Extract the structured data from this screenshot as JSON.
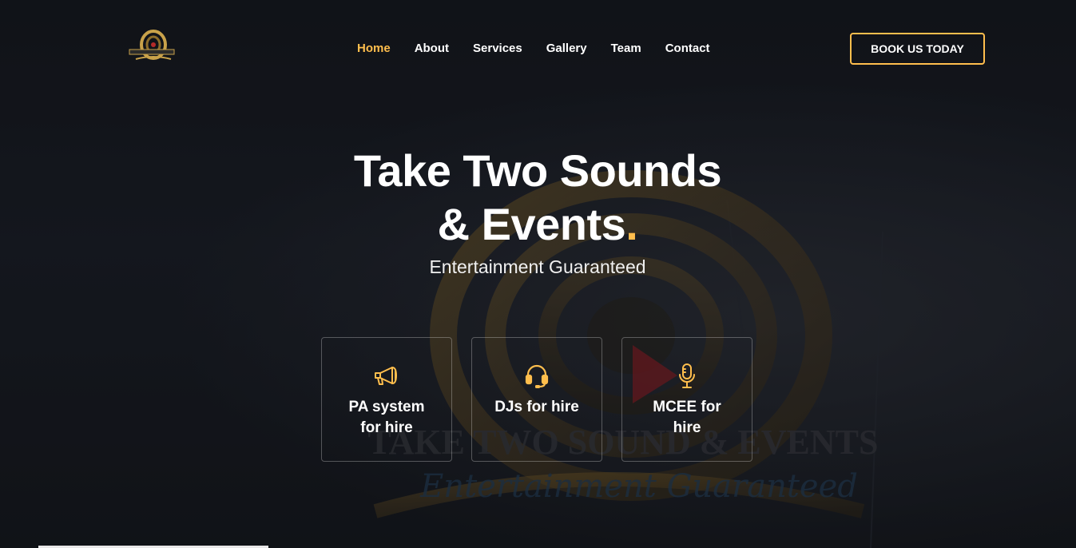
{
  "brand": {
    "logo_icon": "take-two-logo-icon",
    "logo_text": "TAKE TWO SOUND & EVENTS"
  },
  "nav": {
    "items": [
      {
        "label": "Home",
        "active": true
      },
      {
        "label": "About",
        "active": false
      },
      {
        "label": "Services",
        "active": false
      },
      {
        "label": "Gallery",
        "active": false
      },
      {
        "label": "Team",
        "active": false
      },
      {
        "label": "Contact",
        "active": false
      }
    ],
    "cta_label": "BOOK US TODAY"
  },
  "hero": {
    "title_line1": "Take Two Sounds",
    "title_line2": "& Events",
    "title_dot": ".",
    "subtitle": "Entertainment Guaranteed",
    "background_logo_text": "TAKE TWO SOUND & EVENTS",
    "background_logo_tagline": "Entertainment Guaranteed"
  },
  "services": [
    {
      "icon": "megaphone-icon",
      "label": "PA system for hire"
    },
    {
      "icon": "headset-icon",
      "label": "DJs for hire"
    },
    {
      "icon": "microphone-icon",
      "label": "MCEE for hire"
    }
  ],
  "colors": {
    "accent": "#ffbe4d",
    "background": "#16181d",
    "text": "#ffffff"
  }
}
